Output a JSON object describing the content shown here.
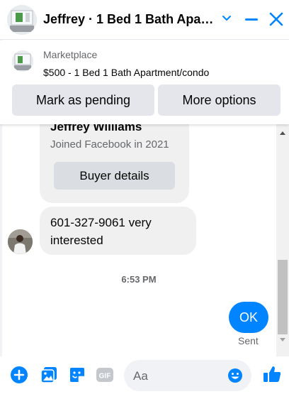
{
  "header": {
    "title": "Jeffrey · 1 Bed 1 Bath Apart…"
  },
  "marketplace": {
    "label": "Marketplace",
    "listing": "$500 - 1 Bed 1 Bath Apartment/condo",
    "pending_button": "Mark as pending",
    "more_button": "More options"
  },
  "messages": {
    "card_name": "Jeffrey Williams",
    "card_joined": "Joined Facebook in 2021",
    "buyer_details_button": "Buyer details",
    "incoming_text": "601-327-9061 very interested",
    "timestamp": "6:53 PM",
    "outgoing_text": "OK",
    "sent_status": "Sent"
  },
  "composer": {
    "placeholder": "Aa"
  },
  "colors": {
    "accent": "#0084ff",
    "bubble_gray": "#f0f0f0",
    "secondary_text": "#65676b"
  },
  "icons": [
    "chevron-down-icon",
    "minimize-icon",
    "close-icon",
    "plus-icon",
    "photo-icon",
    "sticker-icon",
    "gif-icon",
    "emoji-icon",
    "like-icon"
  ]
}
